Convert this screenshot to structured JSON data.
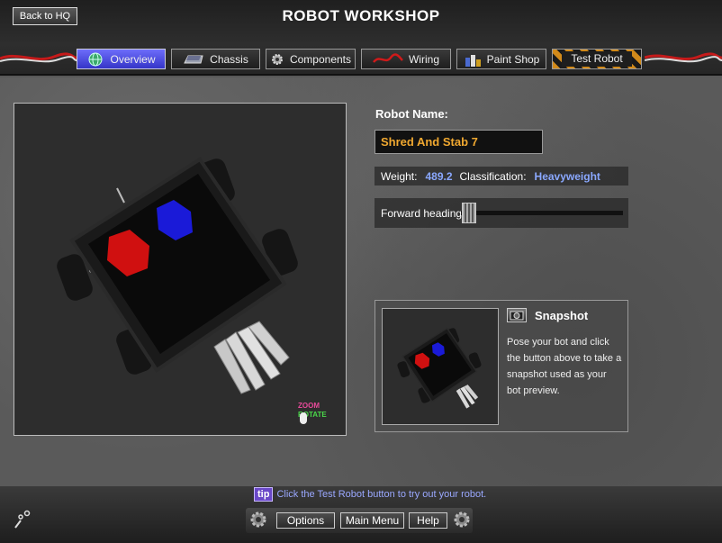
{
  "header": {
    "back_label": "Back to HQ",
    "title": "ROBOT WORKSHOP"
  },
  "tabs": [
    {
      "label": "Overview",
      "icon": "globe-icon",
      "active": true
    },
    {
      "label": "Chassis",
      "icon": "chassis-icon",
      "active": false
    },
    {
      "label": "Components",
      "icon": "gear-icon",
      "active": false
    },
    {
      "label": "Wiring",
      "icon": "wire-icon",
      "active": false
    },
    {
      "label": "Paint Shop",
      "icon": "paint-cans-icon",
      "active": false
    },
    {
      "label": "Test Robot",
      "icon": "hazard-stripes",
      "active": false
    }
  ],
  "viewport": {
    "zoom_hint": "ZOOM",
    "rotate_hint": "ROTATE"
  },
  "robot": {
    "name_label": "Robot Name:",
    "name_value": "Shred And Stab 7",
    "weight_label": "Weight:",
    "weight_value": "489.2",
    "class_label": "Classification:",
    "class_value": "Heavyweight",
    "heading_label": "Forward heading:",
    "heading_value": 0.0
  },
  "snapshot": {
    "title": "Snapshot",
    "description": "Pose your bot and click the button above to take a snapshot used as your bot preview."
  },
  "footer": {
    "tip_badge": "tip",
    "tip_text": "Click the Test Robot button to try out your robot.",
    "options_label": "Options",
    "main_menu_label": "Main Menu",
    "help_label": "Help"
  },
  "colors": {
    "accent_blue": "#4a4ae0",
    "name_orange": "#f0a830",
    "stat_blue": "#8aa8ff",
    "hazard_orange": "#d28a1a",
    "hex_red": "#d01010",
    "hex_blue": "#1a1ad8"
  }
}
